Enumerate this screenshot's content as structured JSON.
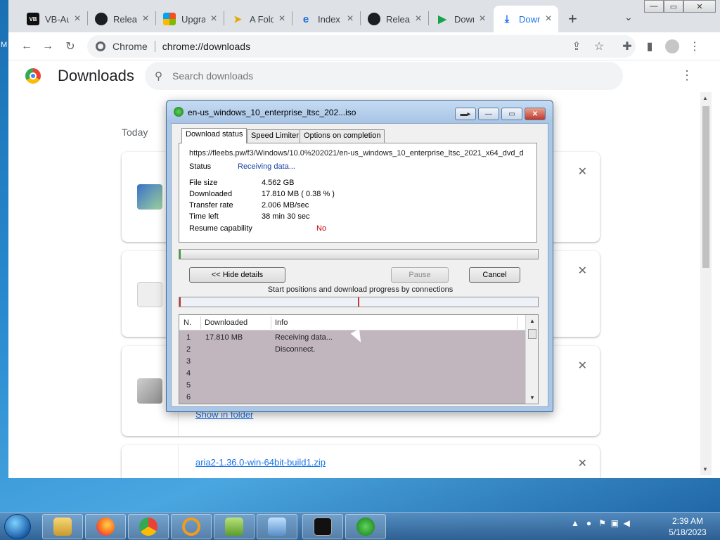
{
  "desktop": {
    "left_edge_char": "M"
  },
  "tabs": [
    {
      "label": "VB-Au",
      "icon": "vb-icon",
      "icon_text": "VB"
    },
    {
      "label": "Releas",
      "icon": "github-icon"
    },
    {
      "label": "Upgra",
      "icon": "windows-icon"
    },
    {
      "label": "A Fold",
      "icon": "folder-arrow-icon"
    },
    {
      "label": "Index",
      "icon": "ie-icon"
    },
    {
      "label": "Releas",
      "icon": "github-icon"
    },
    {
      "label": "Down",
      "icon": "play-icon"
    },
    {
      "label": "Down",
      "icon": "download-icon",
      "active": true
    }
  ],
  "omnibox": {
    "chip": "Chrome",
    "url": "chrome://downloads"
  },
  "downloads_page": {
    "title": "Downloads",
    "search_placeholder": "Search downloads",
    "section": "Today",
    "cards": [
      {
        "link": ""
      },
      {
        "link": ""
      },
      {
        "link": "Show in folder"
      },
      {
        "link": "aria2-1.36.0-win-64bit-build1.zip"
      }
    ]
  },
  "idm": {
    "title": "en-us_windows_10_enterprise_ltsc_202...iso",
    "tabs": [
      "Download status",
      "Speed Limiter",
      "Options on completion"
    ],
    "url": "https://fleebs.pw/f3/Windows/10.0%202021/en-us_windows_10_enterprise_ltsc_2021_x64_dvd_d",
    "status_label": "Status",
    "status_value": "Receiving data...",
    "rows": [
      {
        "label": "File size",
        "value": "4.562  GB"
      },
      {
        "label": "Downloaded",
        "value": "17.810  MB  ( 0.38 % )"
      },
      {
        "label": "Transfer rate",
        "value": "2.006  MB/sec"
      },
      {
        "label": "Time left",
        "value": "38 min 30 sec"
      }
    ],
    "resume_label": "Resume capability",
    "resume_value": "No",
    "progress_fraction": 0.0038,
    "hide_details": "<< Hide details",
    "pause": "Pause",
    "cancel": "Cancel",
    "connections_caption": "Start positions and download progress by connections",
    "table_headers": [
      "N.",
      "Downloaded",
      "Info"
    ],
    "connections": [
      {
        "n": "1",
        "downloaded": "17.810  MB",
        "info": "Receiving data..."
      },
      {
        "n": "2",
        "downloaded": "",
        "info": "Disconnect."
      },
      {
        "n": "3",
        "downloaded": "",
        "info": ""
      },
      {
        "n": "4",
        "downloaded": "",
        "info": ""
      },
      {
        "n": "5",
        "downloaded": "",
        "info": ""
      },
      {
        "n": "6",
        "downloaded": "",
        "info": ""
      }
    ]
  },
  "taskbar": {
    "apps": [
      "file-explorer-icon",
      "firefox-icon",
      "chrome-icon",
      "search-tool-icon",
      "notepad-plus-icon",
      "control-panel-icon",
      "terminal-icon",
      "idm-icon"
    ],
    "clock_time": "2:39 AM",
    "clock_date": "5/18/2023"
  }
}
